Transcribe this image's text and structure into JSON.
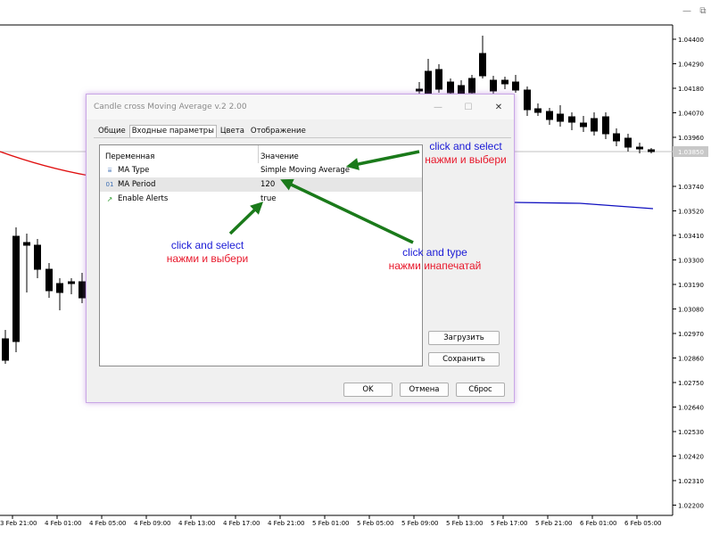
{
  "window_controls": {
    "minimize": "—",
    "restore": "⧉"
  },
  "chart": {
    "price_labels": [
      "1.04400",
      "1.04290",
      "1.04180",
      "1.04070",
      "1.03960",
      "1.03740",
      "1.03520",
      "1.03410",
      "1.03300",
      "1.03190",
      "1.03080",
      "1.02970",
      "1.02860",
      "1.02750",
      "1.02640",
      "1.02530",
      "1.02420",
      "1.02310",
      "1.02200"
    ],
    "current_price": "1.03850",
    "time_labels": [
      "3 Feb 21:00",
      "4 Feb 01:00",
      "4 Feb 05:00",
      "4 Feb 09:00",
      "4 Feb 13:00",
      "4 Feb 17:00",
      "4 Feb 21:00",
      "5 Feb 01:00",
      "5 Feb 05:00",
      "5 Feb 09:00",
      "5 Feb 13:00",
      "5 Feb 17:00",
      "5 Feb 21:00",
      "6 Feb 01:00",
      "6 Feb 05:00"
    ],
    "ma_red_color": "#e01010",
    "ma_blue_color": "#1010c0"
  },
  "dialog": {
    "title": "Candle cross Moving Average v.2 2.00",
    "tabs": [
      "Общие",
      "Входные параметры",
      "Цвета",
      "Отображение"
    ],
    "active_tab": 1,
    "columns": {
      "variable": "Переменная",
      "value": "Значение"
    },
    "params": [
      {
        "icon": "⩸",
        "icon_name": "enum-icon",
        "name": "MA Type",
        "value": "Simple Moving Average"
      },
      {
        "icon": "01",
        "icon_name": "integer-icon",
        "name": "MA Period",
        "value": "120"
      },
      {
        "icon": "↗",
        "icon_name": "bool-icon",
        "name": "Enable Alerts",
        "value": "true"
      }
    ],
    "load_button": "Загрузить",
    "save_button": "Сохранить",
    "ok_button": "OK",
    "cancel_button": "Отмена",
    "reset_button": "Сброс"
  },
  "annotations": [
    {
      "en": "click and select",
      "ru": "нажми и выбери"
    },
    {
      "en": "click and select",
      "ru": "нажми и выбери"
    },
    {
      "en": "click and type",
      "ru": "нажми инапечатай"
    }
  ],
  "colors": {
    "arrow": "#1a7a1a",
    "annotation_en": "#1a1ad6",
    "annotation_ru": "#e8192c",
    "dialog_border": "#c9a6e6"
  }
}
